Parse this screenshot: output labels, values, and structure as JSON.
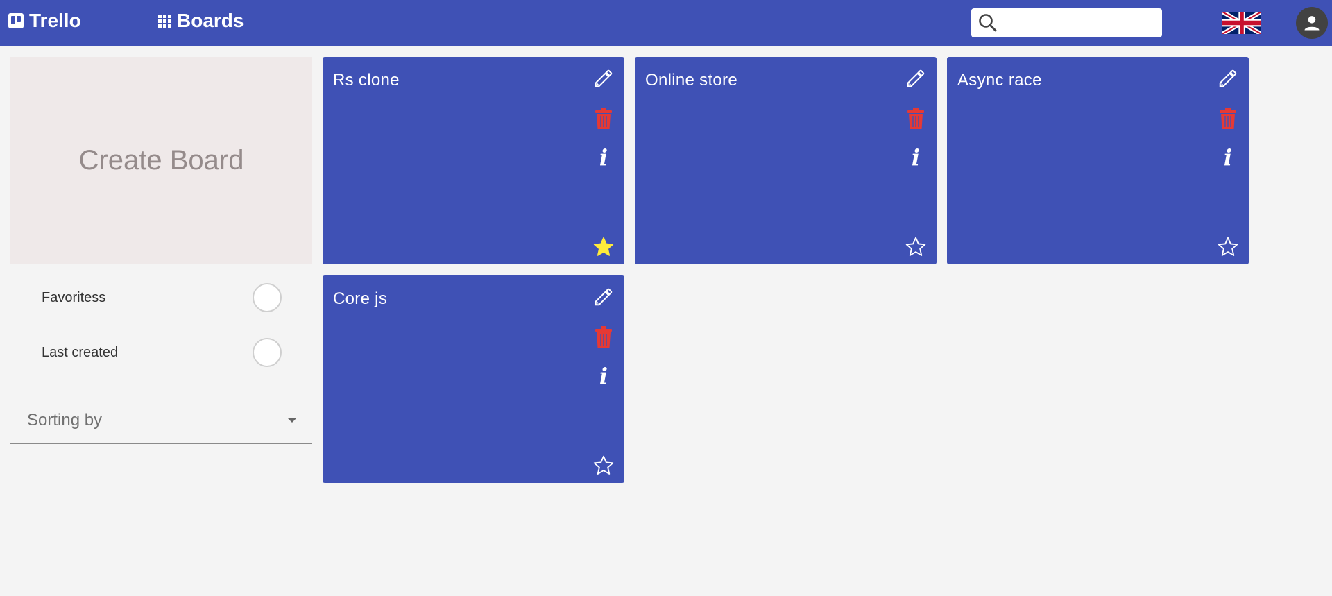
{
  "header": {
    "logo_text": "Trello",
    "boards_label": "Boards",
    "search_placeholder": "",
    "language_flag": "uk-flag-icon",
    "user_icon": "account-icon"
  },
  "sidebar": {
    "create_board_label": "Create Board",
    "filters": [
      {
        "label": "Favoritess",
        "checked": false
      },
      {
        "label": "Last created",
        "checked": false
      }
    ],
    "sort_placeholder": "Sorting by"
  },
  "boards": [
    {
      "title": "Rs clone",
      "favorite": true
    },
    {
      "title": "Online store",
      "favorite": false
    },
    {
      "title": "Async race",
      "favorite": false
    },
    {
      "title": "Core js",
      "favorite": false
    }
  ],
  "colors": {
    "primary": "#3f51b5",
    "delete_icon": "#e53935",
    "favorite_star": "#ffeb3b",
    "create_board_bg": "#efe9e9"
  }
}
